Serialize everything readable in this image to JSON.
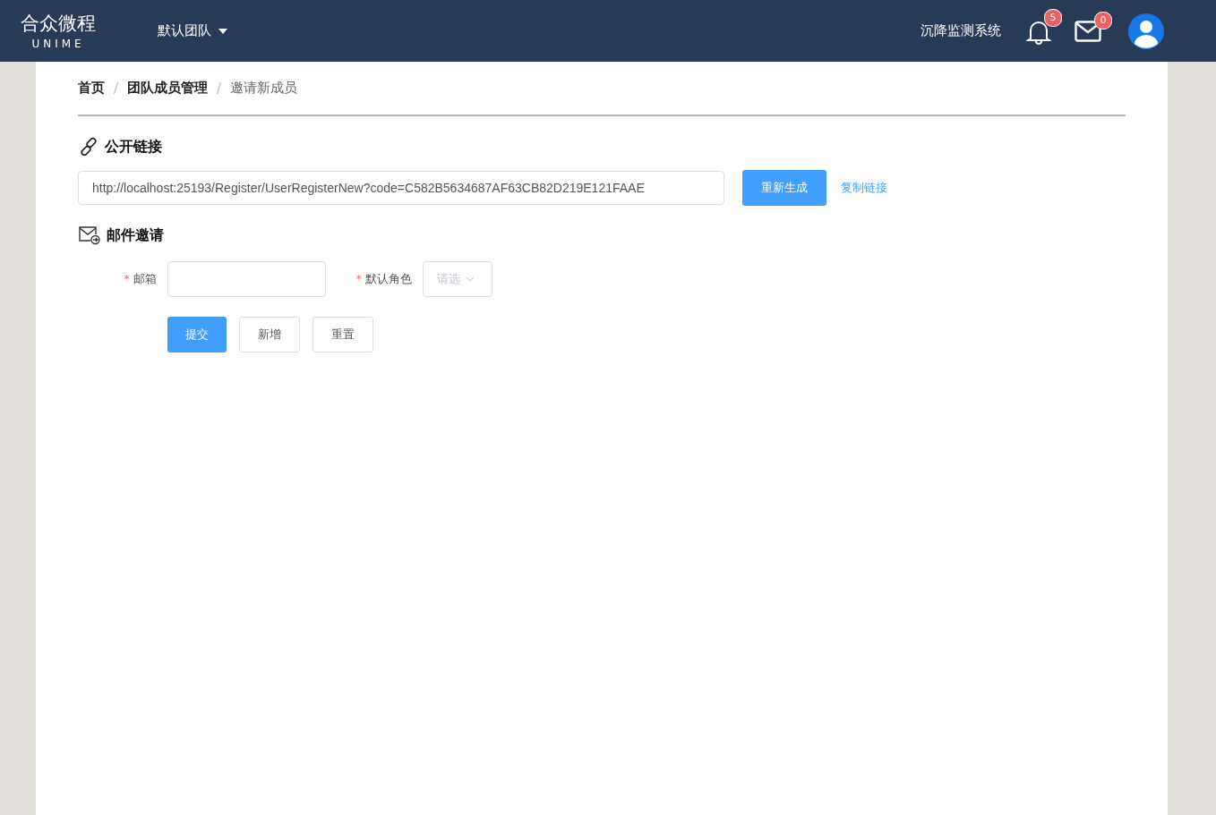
{
  "header": {
    "logo_title": "合众微程",
    "logo_subtitle": "UNIME",
    "team_menu": "默认团队",
    "system_name": "沉降监测系统",
    "notifications_badge": "5",
    "messages_badge": "0"
  },
  "breadcrumb": [
    {
      "label": "首页",
      "current": false
    },
    {
      "separator": "/",
      "label": "团队成员管理",
      "current": false
    },
    {
      "separator": "/",
      "label": "邀请新成员",
      "current": true
    }
  ],
  "public_link": {
    "title": "公开链接",
    "url": "http://localhost:25193/Register/UserRegisterNew?code=C582B5634687AF63CB82D219E121FAAE",
    "regenerate_button": "重新生成",
    "copy_link": "复制链接"
  },
  "email_invite": {
    "title": "邮件邀请",
    "email_label": "邮箱",
    "email_required_mark": "*",
    "role_label": "默认角色",
    "role_required_mark": "*",
    "role_placeholder": "请选",
    "buttons": [
      {
        "label": "提交",
        "kind": "primary"
      },
      {
        "label": "新增",
        "kind": "default"
      },
      {
        "label": "重置",
        "kind": "default"
      }
    ]
  }
}
